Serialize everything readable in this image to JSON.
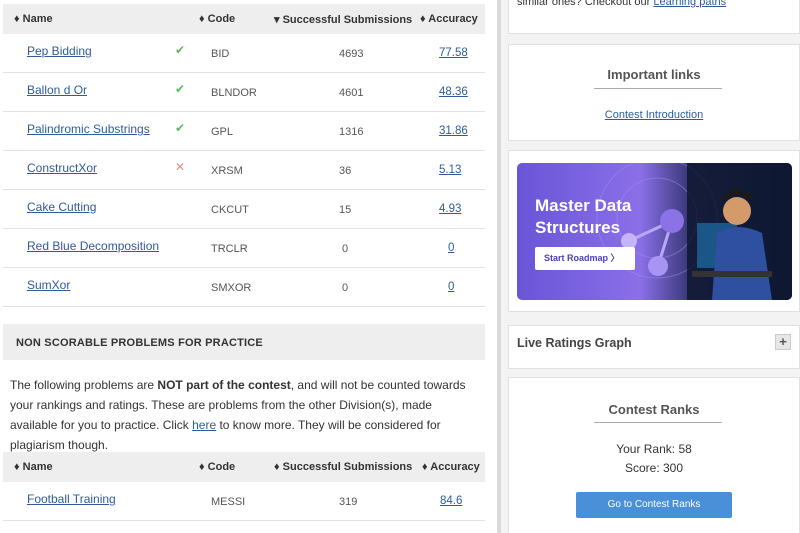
{
  "table1": {
    "headers": {
      "name": "♦ Name",
      "code": "♦ Code",
      "subs": "▾ Successful Submissions",
      "acc": "♦ Accuracy"
    },
    "rows": [
      {
        "name": "Pep Bidding",
        "status": "✔",
        "code": "BID",
        "subs": "4693",
        "acc": "77.58"
      },
      {
        "name": "Ballon d Or",
        "status": "✔",
        "code": "BLNDOR",
        "subs": "4601",
        "acc": "48.36"
      },
      {
        "name": "Palindromic Substrings",
        "status": "✔",
        "code": "GPL",
        "subs": "1316",
        "acc": "31.86"
      },
      {
        "name": "ConstructXor",
        "status": "✕",
        "code": "XRSM",
        "subs": "36",
        "acc": "5.13"
      },
      {
        "name": "Cake Cutting",
        "status": "",
        "code": "CKCUT",
        "subs": "15",
        "acc": "4.93"
      },
      {
        "name": "Red Blue Decomposition",
        "status": "",
        "code": "TRCLR",
        "subs": "0",
        "acc": "0"
      },
      {
        "name": "SumXor",
        "status": "",
        "code": "SMXOR",
        "subs": "0",
        "acc": "0"
      }
    ]
  },
  "nonscorable": {
    "title": "NON SCORABLE PROBLEMS FOR PRACTICE",
    "text_1": "The following problems are ",
    "text_bold": "NOT part of the contest",
    "text_2": ", and will not be counted towards your rankings and ratings. These are problems from the other Division(s), made available for you to practice. Click ",
    "text_link": "here",
    "text_3": " to know more. They will be considered for plagiarism though."
  },
  "table2": {
    "headers": {
      "name": "♦ Name",
      "code": "♦ Code",
      "subs": "♦ Successful Submissions",
      "acc": "♦ Accuracy"
    },
    "rows": [
      {
        "name": "Football Training",
        "code": "MESSI",
        "subs": "319",
        "acc": "84.6"
      }
    ]
  },
  "sidebar": {
    "top_text": "similar ones? Checkout our ",
    "top_link": "Learning paths",
    "important_links": {
      "title": "Important links",
      "link": "Contest Introduction"
    },
    "banner": {
      "title": "Master Data Structures",
      "button": "Start Roadmap  〉"
    },
    "live_ratings": {
      "title": "Live Ratings Graph",
      "toggle": "+"
    },
    "contest_ranks": {
      "title": "Contest Ranks",
      "rank": "Your Rank: 58",
      "score": "Score: 300",
      "button": "Go to Contest Ranks"
    }
  },
  "colors": {
    "link": "#2f5b9a",
    "accepted": "#5cb85c",
    "rejected": "#e88888",
    "primary_button": "#4a90d9"
  }
}
